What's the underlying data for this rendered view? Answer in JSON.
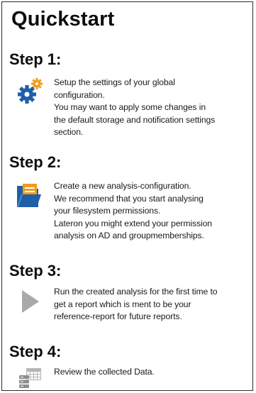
{
  "title": "Quickstart",
  "steps": [
    {
      "heading": "Step 1:",
      "icon": "gear-settings-icon",
      "lines": [
        "Setup the settings of your global",
        "configuration.",
        "You may want to apply some changes in",
        "the default storage and notification settings",
        "section."
      ]
    },
    {
      "heading": "Step 2:",
      "icon": "folder-document-icon",
      "lines": [
        "Create a new analysis-configuration.",
        "We recommend that you start analysing",
        "your filesystem permissions.",
        "Lateron you might extend your permission",
        "analysis on AD and groupmemberships."
      ]
    },
    {
      "heading": "Step 3:",
      "icon": "play-icon",
      "lines": [
        "Run the created analysis for the first time to",
        "get a report which is ment to be your",
        "reference-report for future reports."
      ]
    },
    {
      "heading": "Step 4:",
      "icon": "data-grid-icon",
      "lines": [
        "Review the collected Data."
      ]
    }
  ],
  "colors": {
    "gear_blue": "#1f5fa8",
    "gear_orange": "#f29a1e",
    "folder_blue": "#1f5fa8",
    "folder_orange": "#f29a1e",
    "play_gray": "#a9a9a9",
    "grid_gray": "#8c8c8c"
  }
}
